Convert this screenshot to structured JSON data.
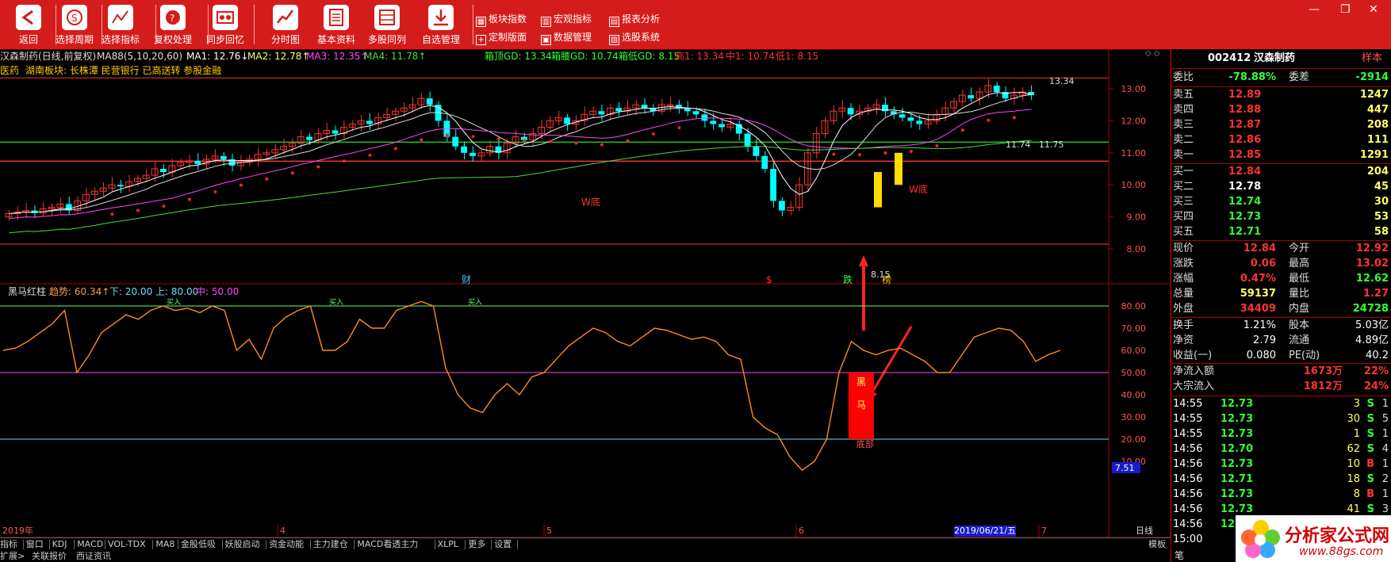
{
  "toolbar": {
    "buttons": [
      {
        "label": "返回",
        "icon": "back-icon"
      },
      {
        "label": "选择周期",
        "icon": "cycle-icon"
      },
      {
        "label": "选择指标",
        "icon": "indicator-icon"
      },
      {
        "label": "复权处理",
        "icon": "rights-icon"
      },
      {
        "label": "同步回忆",
        "icon": "sync-icon"
      },
      {
        "label": "分时图",
        "icon": "intraday-icon"
      },
      {
        "label": "基本资料",
        "icon": "document-icon"
      },
      {
        "label": "多股同列",
        "icon": "multistock-icon"
      },
      {
        "label": "自选管理",
        "icon": "download-icon"
      }
    ],
    "small_buttons": [
      "板块指数",
      "宏观指标",
      "报表分析",
      "定制版面",
      "数据管理",
      "选股系统"
    ]
  },
  "header": {
    "stock_label": "汉森制药(日线,前复权)",
    "ma88": "MA88(5,10,20,60)",
    "ma1": "MA1: 12.76↓",
    "ma2": "MA2: 12.78↑",
    "ma3": "MA3: 12.35↑",
    "ma4": "MA4: 11.78↑",
    "box": "箱顶GD: 13.34",
    "box_mid": "箱腰GD: 10.74",
    "box_low": "箱低GD: 8.15",
    "high": "高1: 13.34",
    "mid": "中1: 10.74",
    "low": "低1: 8.15",
    "sector_prefix": "医药 ",
    "sector": "湖南板块: 长株潭 民营银行 已高送转 参股金融"
  },
  "price_axis": [
    "13.00",
    "12.00",
    "11.00",
    "10.00",
    "9.00",
    "8.00"
  ],
  "annotations": {
    "w_bottom_1": "W底",
    "w_bottom_2": "W底",
    "low_label": "8.15",
    "high_label": "13.34",
    "mid_label": "11.74",
    "mid_label_2": "11.75",
    "events": [
      "财",
      "$",
      "跌",
      "榜"
    ],
    "heima_text_1": "黑",
    "heima_text_2": "马",
    "bottom_label": "底部",
    "buy_labels": [
      "买入",
      "买入",
      "买入"
    ]
  },
  "indicator": {
    "name": "黑马红柱",
    "trend": "趋势: 60.34↑",
    "down": "下: 20.00",
    "up": "上: 80.00",
    "mid": "中: 50.00",
    "axis": [
      "80.00",
      "70.00",
      "60.00",
      "50.00",
      "40.00",
      "30.00",
      "20.00",
      "10.00"
    ],
    "current_label": "7.51"
  },
  "time_axis": {
    "labels": [
      "2019年",
      "4",
      "5",
      "6",
      "7"
    ],
    "cursor_date": "2019/06/21/五",
    "right_label": "日线"
  },
  "bottom_tabs": [
    "指标",
    "窗口",
    "KDJ",
    "MACD",
    "VOL-TDX",
    "MA8",
    "金股低吸",
    "妖股启动",
    "资金动能",
    "主力建仓",
    "MACD看透主力",
    "XLPL",
    "更多",
    "设置"
  ],
  "bottom_row2": [
    "扩展>",
    "关联报价",
    "西证资讯"
  ],
  "template_label": "模板",
  "quote": {
    "code": "002412",
    "name": "汉森制药",
    "badge": "样本",
    "weibi_label": "委比",
    "weibi": "-78.88%",
    "weicha_label": "委差",
    "weicha": "-2914",
    "sell": [
      {
        "label": "卖五",
        "price": "12.89",
        "vol": "1247"
      },
      {
        "label": "卖四",
        "price": "12.88",
        "vol": "447"
      },
      {
        "label": "卖三",
        "price": "12.87",
        "vol": "208"
      },
      {
        "label": "卖二",
        "price": "12.86",
        "vol": "111"
      },
      {
        "label": "卖一",
        "price": "12.85",
        "vol": "1291"
      }
    ],
    "buy": [
      {
        "label": "买一",
        "price": "12.84",
        "vol": "204"
      },
      {
        "label": "买二",
        "price": "12.78",
        "vol": "45"
      },
      {
        "label": "买三",
        "price": "12.74",
        "vol": "30"
      },
      {
        "label": "买四",
        "price": "12.73",
        "vol": "53"
      },
      {
        "label": "买五",
        "price": "12.71",
        "vol": "58"
      }
    ],
    "stats": [
      {
        "l1": "现价",
        "v1": "12.84",
        "l2": "今开",
        "v2": "12.92"
      },
      {
        "l1": "涨跌",
        "v1": "0.06",
        "l2": "最高",
        "v2": "13.02"
      },
      {
        "l1": "涨幅",
        "v1": "0.47%",
        "l2": "最低",
        "v2": "12.62"
      },
      {
        "l1": "总量",
        "v1": "59137",
        "l2": "量比",
        "v2": "1.27"
      },
      {
        "l1": "外盘",
        "v1": "34409",
        "l2": "内盘",
        "v2": "24728"
      }
    ],
    "stats2": [
      {
        "l1": "换手",
        "v1": "1.21%",
        "l2": "股本",
        "v2": "5.03亿"
      },
      {
        "l1": "净资",
        "v1": "2.79",
        "l2": "流通",
        "v2": "4.89亿"
      },
      {
        "l1": "收益(一)",
        "v1": "0.080",
        "l2": "PE(动)",
        "v2": "40.2"
      }
    ],
    "flows": [
      {
        "label": "净流入额",
        "value": "1673万",
        "pct": "22%"
      },
      {
        "label": "大宗流入",
        "value": "1812万",
        "pct": "24%"
      }
    ],
    "ticks": [
      {
        "t": "14:55",
        "p": "12.73",
        "v": "3",
        "s": "S",
        "n": "1"
      },
      {
        "t": "14:55",
        "p": "12.73",
        "v": "30",
        "s": "S",
        "n": "5"
      },
      {
        "t": "14:55",
        "p": "12.73",
        "v": "1",
        "s": "S",
        "n": "1"
      },
      {
        "t": "14:56",
        "p": "12.70",
        "v": "62",
        "s": "S",
        "n": "4"
      },
      {
        "t": "14:56",
        "p": "12.73",
        "v": "10",
        "s": "B",
        "n": "1"
      },
      {
        "t": "14:56",
        "p": "12.71",
        "v": "18",
        "s": "S",
        "n": "2"
      },
      {
        "t": "14:56",
        "p": "12.73",
        "v": "8",
        "s": "B",
        "n": "1"
      },
      {
        "t": "14:56",
        "p": "12.73",
        "v": "41",
        "s": "S",
        "n": "3"
      },
      {
        "t": "14:56",
        "p": "12.73",
        "v": "",
        "s": "",
        "n": ""
      },
      {
        "t": "15:00",
        "p": "",
        "v": "",
        "s": "",
        "n": ""
      }
    ],
    "bottom_tab": "笔"
  },
  "logo": {
    "name": "分析家公式网",
    "url": "www.88gs.com"
  },
  "colors": {
    "up": "#ff3333",
    "down": "#00ffff",
    "ma1": "#ffffff",
    "ma2": "#ffff66",
    "ma3": "#ff44ff",
    "ma4": "#44dd44",
    "panel_border": "#aa0000"
  }
}
